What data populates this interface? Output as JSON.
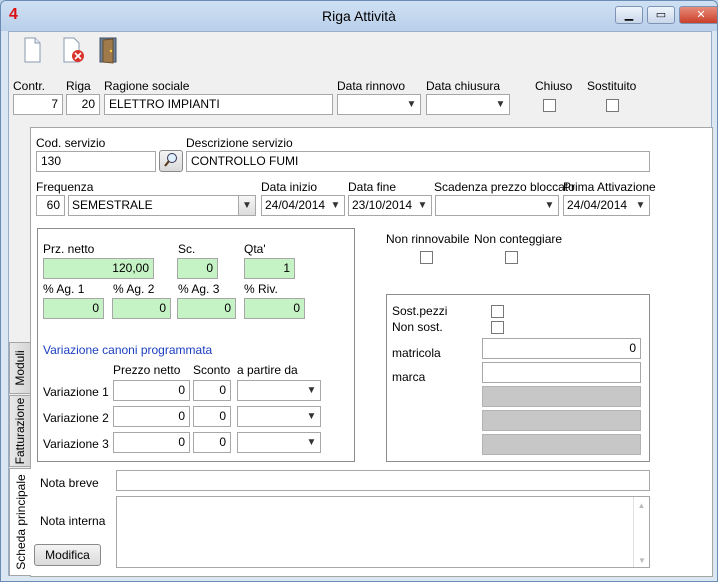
{
  "window": {
    "title": "Riga Attività",
    "app_icon": "4"
  },
  "toolbar": {
    "icons": [
      "new-document-icon",
      "delete-document-icon",
      "exit-door-icon"
    ]
  },
  "header": {
    "contr_label": "Contr.",
    "contr_value": "7",
    "riga_label": "Riga",
    "riga_value": "20",
    "ragione_label": "Ragione sociale",
    "ragione_value": "ELETTRO IMPIANTI",
    "data_rinnovo_label": "Data rinnovo",
    "data_rinnovo_value": "",
    "data_chiusura_label": "Data chiusura",
    "data_chiusura_value": "",
    "chiuso_label": "Chiuso",
    "sostituito_label": "Sostituito"
  },
  "tabs": [
    "Moduli",
    "Fatturazione",
    "Scheda principale"
  ],
  "service": {
    "cod_label": "Cod. servizio",
    "cod_value": "130",
    "desc_label": "Descrizione servizio",
    "desc_value": "CONTROLLO FUMI",
    "freq_label": "Frequenza",
    "freq_num": "60",
    "freq_value": "SEMESTRALE",
    "data_inizio_label": "Data inizio",
    "data_inizio_value": "24/04/2014",
    "data_fine_label": "Data fine",
    "data_fine_value": "23/10/2014",
    "scadenza_label": "Scadenza prezzo bloccato",
    "scadenza_value": "",
    "prima_label": "Prima Attivazione",
    "prima_value": "24/04/2014"
  },
  "prices": {
    "prz_label": "Prz. netto",
    "prz_value": "120,00",
    "sc_label": "Sc.",
    "sc_value": "0",
    "qta_label": "Qta'",
    "qta_value": "1",
    "ag1_label": "% Ag. 1",
    "ag1_value": "0",
    "ag2_label": "% Ag. 2",
    "ag2_value": "0",
    "ag3_label": "% Ag. 3",
    "ag3_value": "0",
    "riv_label": "% Riv.",
    "riv_value": "0"
  },
  "variations": {
    "title": "Variazione canoni programmata",
    "col_prezzo": "Prezzo netto",
    "col_sconto": "Sconto",
    "col_partire": "a partire da",
    "rows": [
      {
        "label": "Variazione 1",
        "prezzo": "0",
        "sconto": "0",
        "data": ""
      },
      {
        "label": "Variazione 2",
        "prezzo": "0",
        "sconto": "0",
        "data": ""
      },
      {
        "label": "Variazione 3",
        "prezzo": "0",
        "sconto": "0",
        "data": ""
      }
    ]
  },
  "flags": {
    "non_rinnovabile_label": "Non rinnovabile",
    "non_conteggiare_label": "Non conteggiare"
  },
  "parts": {
    "sost_pezzi_label": "Sost.pezzi",
    "non_sost_label": "Non sost.",
    "matricola_label": "matricola",
    "matricola_value": "0",
    "marca_label": "marca",
    "marca_value": ""
  },
  "notes": {
    "breve_label": "Nota breve",
    "breve_value": "",
    "interna_label": "Nota interna",
    "interna_value": "",
    "modifica_label": "Modifica"
  }
}
